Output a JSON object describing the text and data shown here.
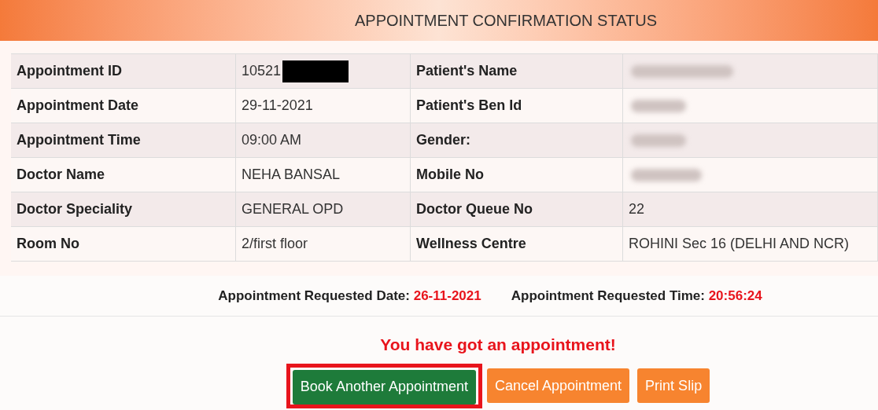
{
  "header": {
    "title": "APPOINTMENT CONFIRMATION STATUS"
  },
  "table": {
    "rows": [
      {
        "cells": [
          {
            "kind": "label",
            "text": "Appointment ID"
          },
          {
            "kind": "value",
            "text": "10521",
            "redacted": true
          },
          {
            "kind": "label",
            "text": "Patient's Name"
          },
          {
            "kind": "value",
            "redacted": true
          }
        ]
      },
      {
        "cells": [
          {
            "kind": "label",
            "text": "Appointment Date"
          },
          {
            "kind": "value",
            "text": "29-11-2021"
          },
          {
            "kind": "label",
            "text": "Patient's Ben Id"
          },
          {
            "kind": "value",
            "redacted": true
          }
        ]
      },
      {
        "cells": [
          {
            "kind": "label",
            "text": "Appointment Time"
          },
          {
            "kind": "value",
            "text": "09:00 AM"
          },
          {
            "kind": "label",
            "text": "Gender:"
          },
          {
            "kind": "value",
            "redacted": true
          }
        ]
      },
      {
        "cells": [
          {
            "kind": "label",
            "text": "Doctor Name"
          },
          {
            "kind": "value",
            "text": "NEHA BANSAL"
          },
          {
            "kind": "label",
            "text": "Mobile No"
          },
          {
            "kind": "value",
            "redacted": true
          }
        ]
      },
      {
        "cells": [
          {
            "kind": "label",
            "text": "Doctor Speciality"
          },
          {
            "kind": "value",
            "text": "GENERAL OPD"
          },
          {
            "kind": "label",
            "text": "Doctor Queue No"
          },
          {
            "kind": "value",
            "text": "22"
          }
        ]
      },
      {
        "cells": [
          {
            "kind": "label",
            "text": "Room No"
          },
          {
            "kind": "value",
            "text": "2/first floor"
          },
          {
            "kind": "label",
            "text": "Wellness Centre"
          },
          {
            "kind": "value",
            "text": "ROHINI Sec 16 (DELHI AND NCR)"
          }
        ]
      }
    ]
  },
  "requested": [
    {
      "label": "Appointment Requested Date:",
      "value": "26-11-2021"
    },
    {
      "label": "Appointment Requested Time:",
      "value": "20:56:24"
    }
  ],
  "message": "You have got an appointment!",
  "buttons": [
    {
      "label": "Book Another Appointment",
      "kind": "success",
      "highlighted": true
    },
    {
      "label": "Cancel Appointment",
      "kind": "warning",
      "highlighted": false
    },
    {
      "label": "Print Slip",
      "kind": "warning",
      "highlighted": false
    }
  ]
}
